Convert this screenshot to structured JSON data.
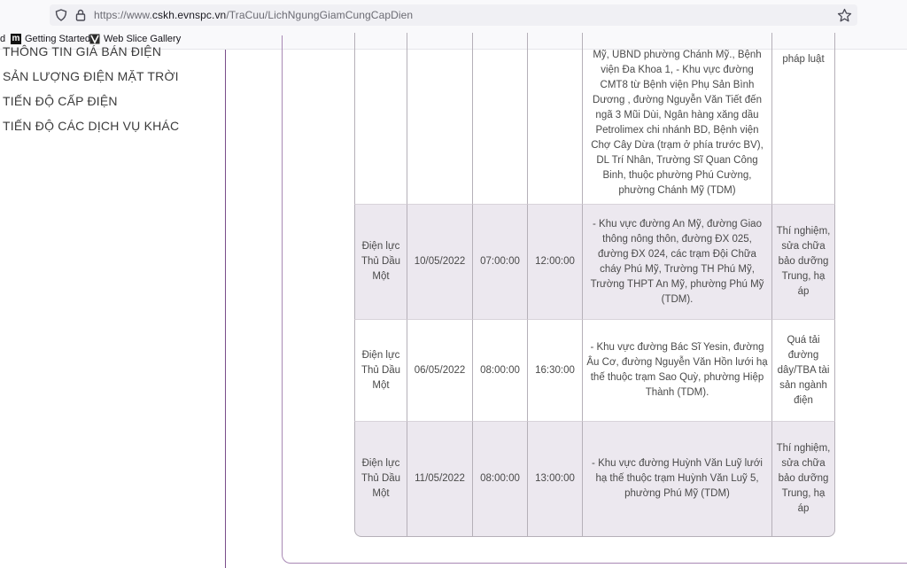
{
  "browser": {
    "url_prefix": "https://www.",
    "url_host": "cskh.evnspc.vn",
    "url_path": "/TraCuu/LichNgungGiamCungCapDien",
    "bookmarks": [
      {
        "label": "d"
      },
      {
        "label": "Getting Started"
      },
      {
        "label": "Web Slice Gallery"
      }
    ]
  },
  "sidebar": {
    "items": [
      {
        "label": "THÔNG TIN GIÁ BÁN ĐIỆN"
      },
      {
        "label": "SẢN LƯỢNG ĐIỆN MẶT TRỜI"
      },
      {
        "label": "TIẾN ĐỘ CẤP ĐIỆN"
      },
      {
        "label": "TIẾN ĐỘ CÁC DỊCH VỤ KHÁC"
      }
    ]
  },
  "table": {
    "rows": [
      {
        "unit": "",
        "date": "",
        "start": "",
        "end": "",
        "area": "Mỹ, UBND phường Chánh Mỹ., Bệnh viện Đa Khoa 1, - Khu vực đường CMT8 từ Bệnh viện Phụ Sản Bình Dương , đường Nguyễn Văn Tiết đến ngã 3 Mũi Dùi, Ngân hàng xăng dầu Petrolimex chi nhánh BD, Bệnh viện Chợ Cây Dừa (trạm ở phía trước BV), DL Trí Nhân, Trường Sĩ Quan Công Binh, thuộc phường Phú Cường, phường Chánh Mỹ (TDM)",
        "reason": "pháp luật"
      },
      {
        "unit": "Điện lực Thủ Dầu Một",
        "date": "10/05/2022",
        "start": "07:00:00",
        "end": "12:00:00",
        "area": "- Khu vực đường An Mỹ, đường Giao thông nông thôn, đường ĐX 025, đường ĐX 024, các trạm Đội Chữa cháy Phú Mỹ, Trường TH Phú Mỹ, Trường THPT An Mỹ, phường Phú Mỹ (TDM).",
        "reason": "Thí nghiệm, sửa chữa bảo dưỡng Trung, hạ áp"
      },
      {
        "unit": "Điện lực Thủ Dầu Một",
        "date": "06/05/2022",
        "start": "08:00:00",
        "end": "16:30:00",
        "area": "- Khu vực đường Bác Sĩ Yesin, đường Âu Cơ, đường Nguyễn Văn Hồn lưới hạ thế thuộc trạm Sao Quỳ, phường Hiệp Thành (TDM).",
        "reason": "Quá tải đường dây/TBA tài sản ngành điện"
      },
      {
        "unit": "Điện lực Thủ Dầu Một",
        "date": "11/05/2022",
        "start": "08:00:00",
        "end": "13:00:00",
        "area": "- Khu vực đường Huỳnh Văn Luỹ lưới hạ thế thuộc trạm Huỳnh Văn Luỹ 5, phường Phú Mỹ (TDM)",
        "reason": "Thí nghiệm, sửa chữa bảo dưỡng Trung, hạ áp"
      }
    ]
  }
}
